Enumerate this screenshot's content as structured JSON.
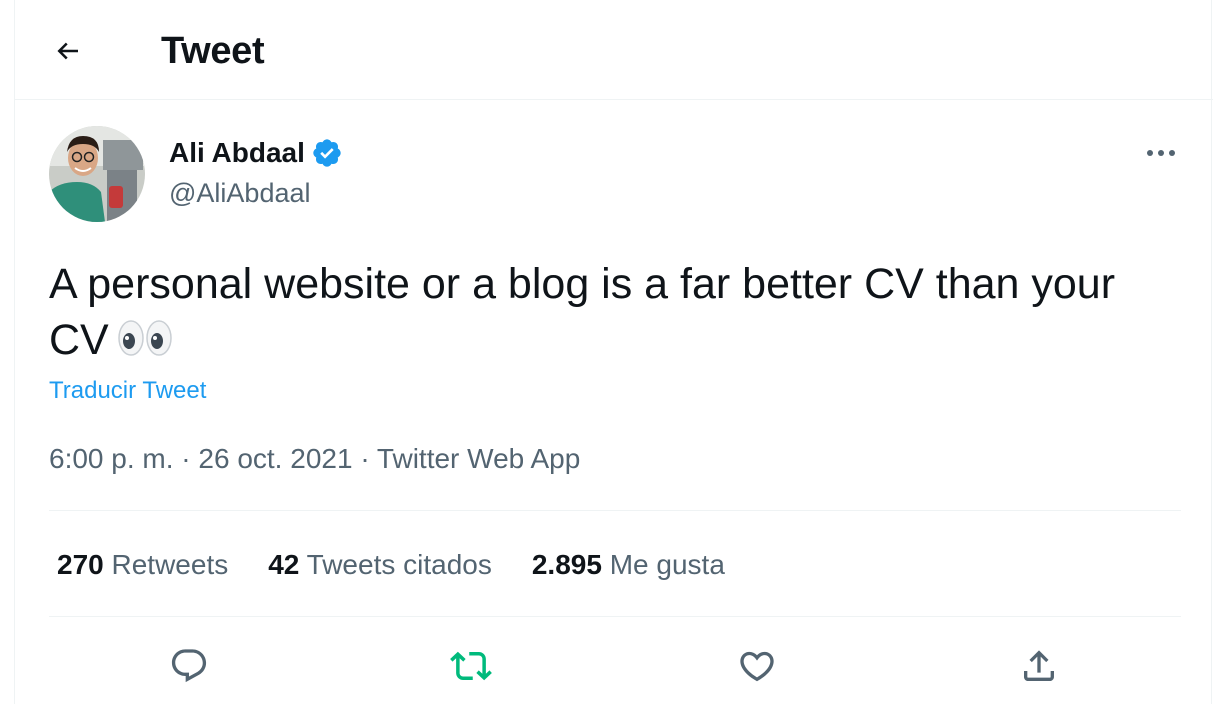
{
  "header": {
    "title": "Tweet"
  },
  "tweet": {
    "author_name": "Ali Abdaal",
    "author_handle": "@AliAbdaal",
    "verified": true,
    "text": "A personal website or a blog is a far better CV than your CV",
    "emoji": "eyes",
    "translate_label": "Traducir Tweet",
    "time": "6:00 p. m.",
    "separator": "·",
    "date": "26 oct. 2021",
    "source": "Twitter Web App"
  },
  "stats": [
    {
      "count": "270",
      "label": "Retweets"
    },
    {
      "count": "42",
      "label": "Tweets citados"
    },
    {
      "count": "2.895",
      "label": "Me gusta"
    }
  ],
  "actions": [
    "reply-icon",
    "retweet-icon",
    "like-icon",
    "share-icon"
  ],
  "colors": {
    "accent": "#1d9bf0",
    "retweet": "#00ba7c",
    "secondary_text": "#536471",
    "primary_text": "#0f1419",
    "border": "#eff3f4"
  }
}
